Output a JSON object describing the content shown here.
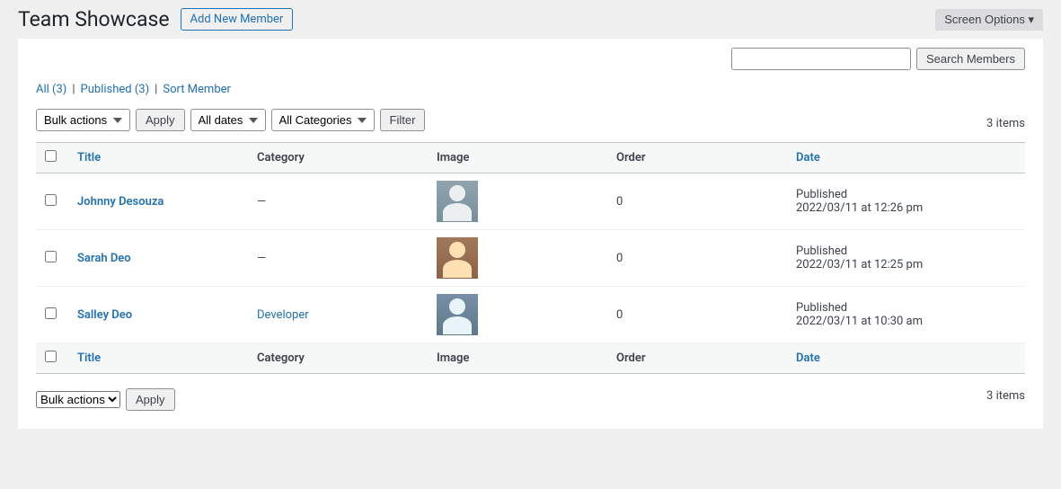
{
  "header": {
    "title": "Team Showcase",
    "add_new_label": "Add New Member",
    "screen_options_label": "Screen Options ▾"
  },
  "filters": {
    "bulk_actions_label": "Bulk actions",
    "all_dates_label": "All dates",
    "all_categories_label": "All Categories",
    "apply_label": "Apply",
    "filter_label": "Filter"
  },
  "subsubsub": {
    "all_label": "All",
    "all_count": "(3)",
    "published_label": "Published",
    "published_count": "(3)",
    "sort_label": "Sort Member",
    "sep1": "|",
    "sep2": "|"
  },
  "search": {
    "placeholder": "",
    "button_label": "Search Members"
  },
  "table": {
    "item_count": "3 items",
    "columns": {
      "title": "Title",
      "category": "Category",
      "image": "Image",
      "order": "Order",
      "date": "Date"
    },
    "rows": [
      {
        "id": 1,
        "name": "Johnny Desouza",
        "category": "—",
        "order": "0",
        "status": "Published",
        "date": "2022/03/11 at 12:26 pm",
        "avatar_type": "male"
      },
      {
        "id": 2,
        "name": "Sarah Deo",
        "category": "—",
        "order": "0",
        "status": "Published",
        "date": "2022/03/11 at 12:25 pm",
        "avatar_type": "female1"
      },
      {
        "id": 3,
        "name": "Salley Deo",
        "category": "Developer",
        "order": "0",
        "status": "Published",
        "date": "2022/03/11 at 10:30 am",
        "avatar_type": "female2"
      }
    ]
  }
}
